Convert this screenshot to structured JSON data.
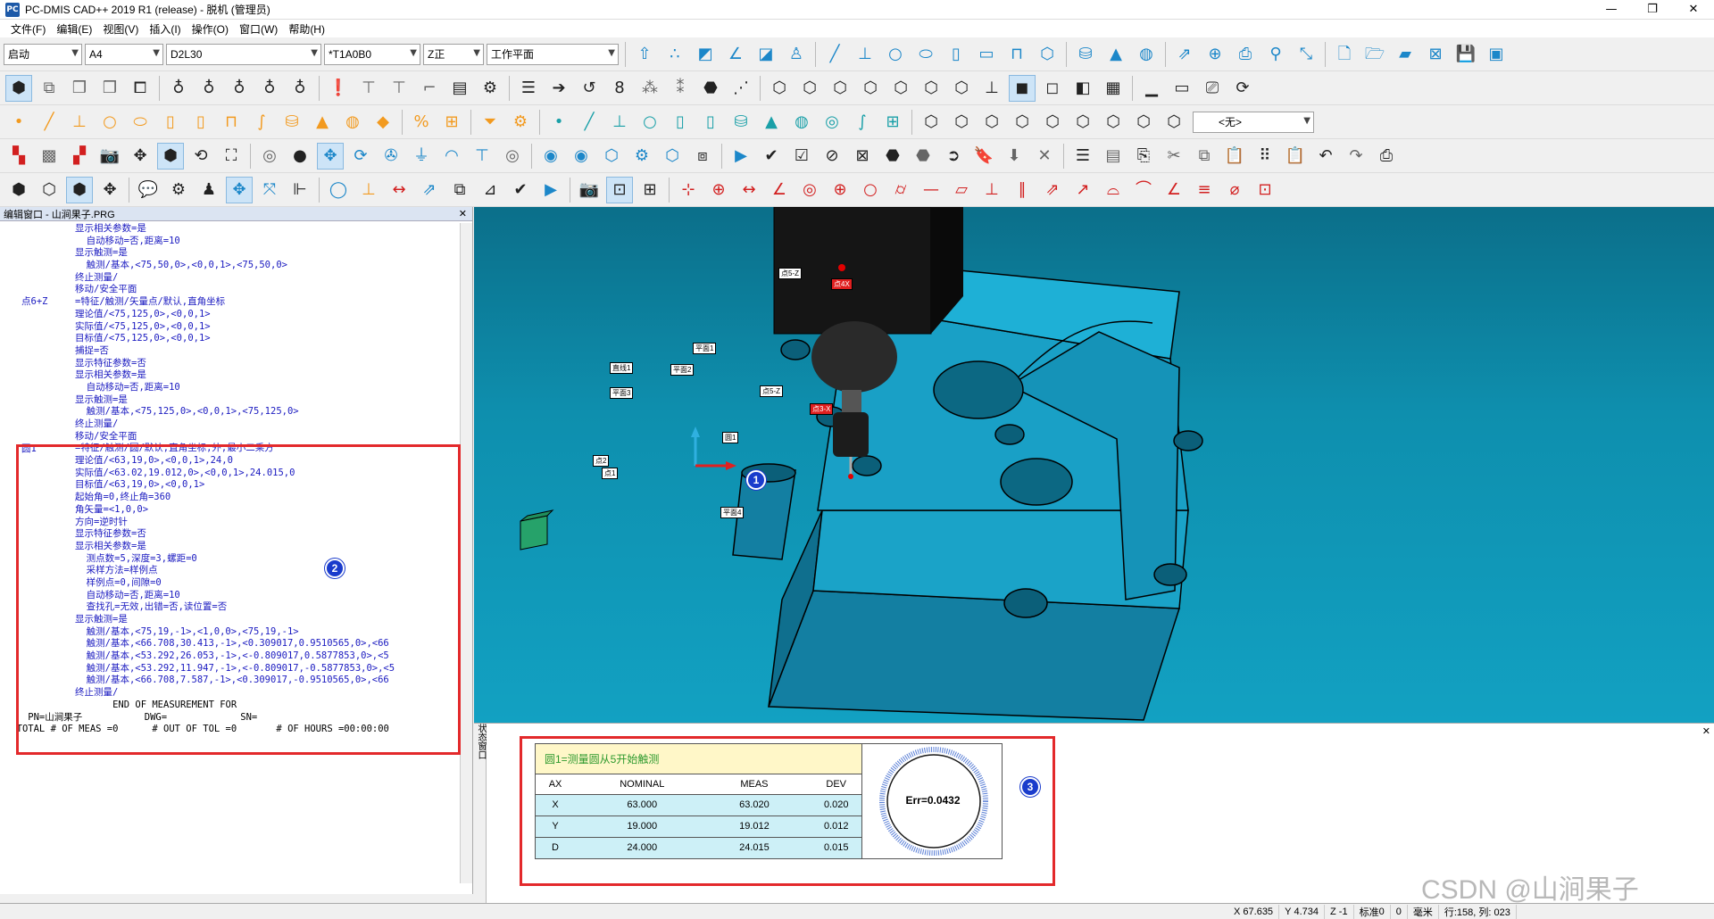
{
  "window": {
    "title": "PC-DMIS CAD++ 2019 R1 (release) - 脱机 (管理员)",
    "app_icon": "PC",
    "controls": [
      "—",
      "❐",
      "✕"
    ]
  },
  "menu": [
    "文件(F)",
    "编辑(E)",
    "视图(V)",
    "插入(I)",
    "操作(O)",
    "窗口(W)",
    "帮助(H)"
  ],
  "toolbar_combos": {
    "mode": "启动",
    "probe_file": "A4",
    "probe": "D2L30",
    "tip": "*T1A0B0",
    "axis": "Z正",
    "workplane": "工作平面",
    "clearance": "<无>"
  },
  "edit_window": {
    "title": "编辑窗口 - 山涧果子.PRG",
    "lines": [
      {
        "label": "",
        "text": "显示相关参数=是"
      },
      {
        "label": "",
        "text": "  自动移动=否,距离=10"
      },
      {
        "label": "",
        "text": "显示触测=是"
      },
      {
        "label": "",
        "text": "  触测/基本,<75,50,0>,<0,0,1>,<75,50,0>"
      },
      {
        "label": "",
        "text": "终止测量/"
      },
      {
        "label": "",
        "text": "移动/安全平面"
      },
      {
        "label": "点6+Z",
        "text": "=特征/触测/矢量点/默认,直角坐标"
      },
      {
        "label": "",
        "text": "理论值/<75,125,0>,<0,0,1>"
      },
      {
        "label": "",
        "text": "实际值/<75,125,0>,<0,0,1>"
      },
      {
        "label": "",
        "text": "目标值/<75,125,0>,<0,0,1>"
      },
      {
        "label": "",
        "text": "捕捉=否"
      },
      {
        "label": "",
        "text": "显示特征参数=否"
      },
      {
        "label": "",
        "text": "显示相关参数=是"
      },
      {
        "label": "",
        "text": "  自动移动=否,距离=10"
      },
      {
        "label": "",
        "text": "显示触测=是"
      },
      {
        "label": "",
        "text": "  触测/基本,<75,125,0>,<0,0,1>,<75,125,0>"
      },
      {
        "label": "",
        "text": "终止测量/"
      },
      {
        "label": "",
        "text": "移动/安全平面"
      },
      {
        "label": "圆1",
        "text": "=特征/触测/圆/默认,直角坐标,外,最小二乘方"
      },
      {
        "label": "",
        "text": "理论值/<63,19,0>,<0,0,1>,24,0"
      },
      {
        "label": "",
        "text": "实际值/<63.02,19.012,0>,<0,0,1>,24.015,0"
      },
      {
        "label": "",
        "text": "目标值/<63,19,0>,<0,0,1>"
      },
      {
        "label": "",
        "text": "起始角=0,终止角=360"
      },
      {
        "label": "",
        "text": "角矢量=<1,0,0>"
      },
      {
        "label": "",
        "text": "方向=逆时针"
      },
      {
        "label": "",
        "text": "显示特征参数=否"
      },
      {
        "label": "",
        "text": "显示相关参数=是"
      },
      {
        "label": "",
        "text": "  测点数=5,深度=3,螺距=0"
      },
      {
        "label": "",
        "text": "  采样方法=样例点"
      },
      {
        "label": "",
        "text": "  样例点=0,间隙=0"
      },
      {
        "label": "",
        "text": "  自动移动=否,距离=10"
      },
      {
        "label": "",
        "text": "  查找孔=无效,出错=否,读位置=否"
      },
      {
        "label": "",
        "text": "显示触测=是"
      },
      {
        "label": "",
        "text": "  触测/基本,<75,19,-1>,<1,0,0>,<75,19,-1>"
      },
      {
        "label": "",
        "text": "  触测/基本,<66.708,30.413,-1>,<0.309017,0.9510565,0>,<66"
      },
      {
        "label": "",
        "text": "  触测/基本,<53.292,26.053,-1>,<-0.809017,0.5877853,0>,<5"
      },
      {
        "label": "",
        "text": "  触测/基本,<53.292,11.947,-1>,<-0.809017,-0.5877853,0>,<5"
      },
      {
        "label": "",
        "text": "  触测/基本,<66.708,7.587,-1>,<0.309017,-0.9510565,0>,<66"
      },
      {
        "label": "",
        "text": "终止测量/"
      }
    ],
    "footer_lines": [
      "                   END OF MEASUREMENT FOR",
      "    PN=山涧果子           DWG=             SN=",
      "  TOTAL # OF MEAS =0      # OUT OF TOL =0       # OF HOURS =00:00:00"
    ]
  },
  "viewport": {
    "labels": [
      "点5-Z",
      "点4X",
      "平面1",
      "平面2",
      "直线1",
      "平面3",
      "点5-Z",
      "点3-X",
      "圆1",
      "点2",
      "点1",
      "平面4"
    ]
  },
  "markers": [
    "1",
    "2",
    "3"
  ],
  "measurement": {
    "title": "圆1=测量圆从5开始触测",
    "columns": [
      "AX",
      "NOMINAL",
      "MEAS",
      "DEV"
    ],
    "rows": [
      [
        "X",
        "63.000",
        "63.020",
        "0.020"
      ],
      [
        "Y",
        "19.000",
        "19.012",
        "0.012"
      ],
      [
        "D",
        "24.000",
        "24.015",
        "0.015"
      ]
    ],
    "error_label": "Err=0.0432"
  },
  "status_side_label": "状态窗口",
  "statusbar": {
    "x_label": "X",
    "x": "67.635",
    "y_label": "Y",
    "y": "4.734",
    "z_label": "Z",
    "z": "-1",
    "std_label": "标准",
    "std": "0",
    "zero": "0",
    "units": "毫米",
    "position": "行:158, 列: 023"
  },
  "watermark": "CSDN @山涧果子",
  "colors": {
    "viewport_bg": "#0e8fae",
    "part": "#1a9cc4",
    "highlight_red": "#e3292b",
    "marker_blue": "#1a3ccc"
  }
}
